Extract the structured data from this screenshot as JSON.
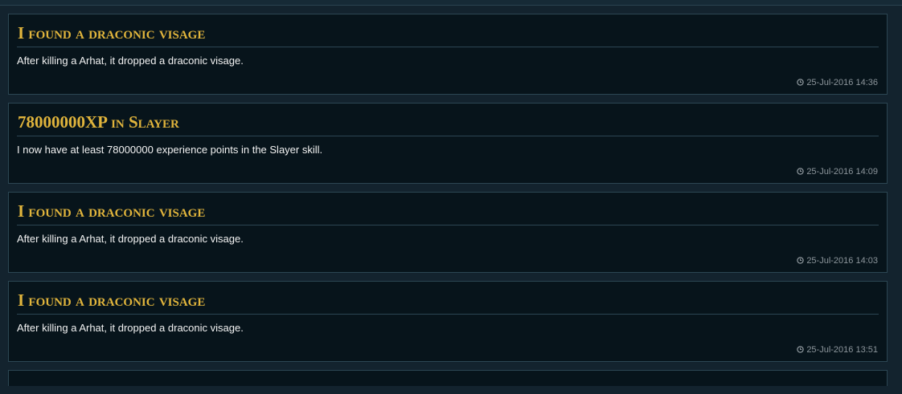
{
  "feed": {
    "items": [
      {
        "title": "I found a draconic visage",
        "text": "After killing a Arhat, it dropped a draconic visage.",
        "time": "25-Jul-2016 14:36"
      },
      {
        "title": "78000000XP in Slayer",
        "text": "I now have at least 78000000 experience points in the Slayer skill.",
        "time": "25-Jul-2016 14:09"
      },
      {
        "title": "I found a draconic visage",
        "text": "After killing a Arhat, it dropped a draconic visage.",
        "time": "25-Jul-2016 14:03"
      },
      {
        "title": "I found a draconic visage",
        "text": "After killing a Arhat, it dropped a draconic visage.",
        "time": "25-Jul-2016 13:51"
      }
    ]
  },
  "icons": {
    "timestamp": "clock-icon"
  },
  "colors": {
    "page_bg": "#13232e",
    "card_bg": "#07141b",
    "card_border": "#2c4653",
    "title": "#e0b43c",
    "text": "#f2f2f2",
    "timestamp": "#8c959b"
  }
}
